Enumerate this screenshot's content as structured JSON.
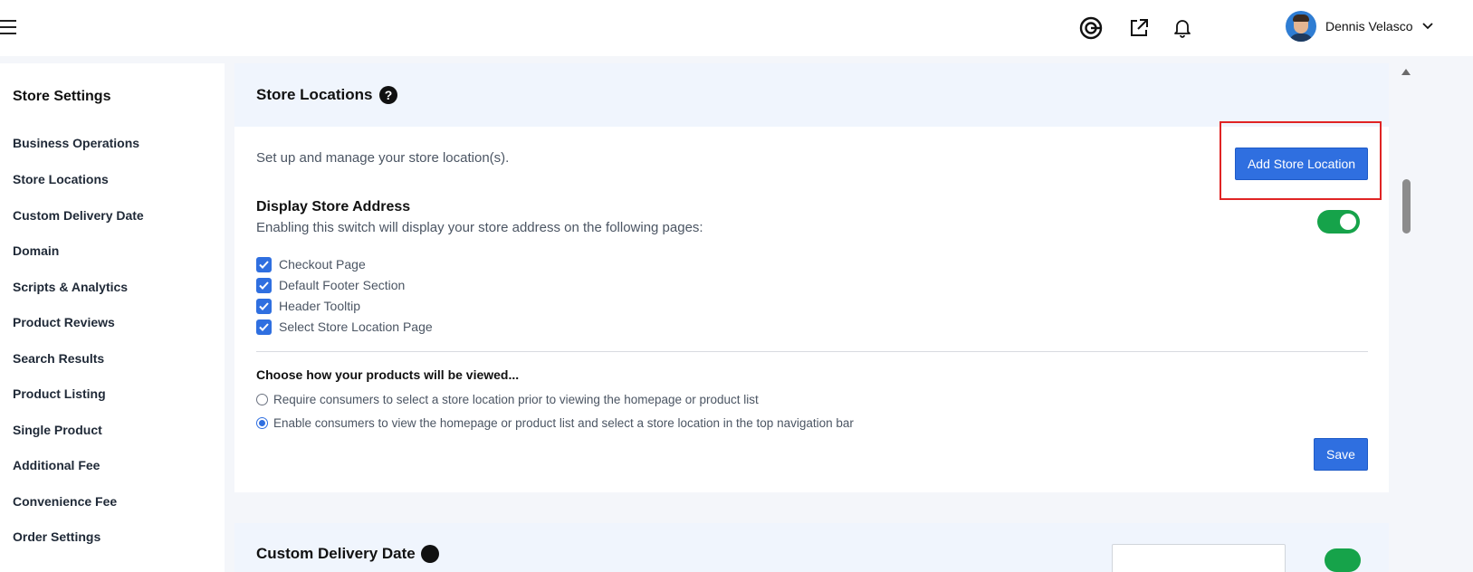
{
  "header": {
    "user_name": "Dennis Velasco",
    "icons": [
      "menu-icon",
      "target-icon",
      "external-link-icon",
      "bell-icon",
      "chevron-down-icon"
    ]
  },
  "sidebar": {
    "title": "Store Settings",
    "items": [
      {
        "label": "Business Operations"
      },
      {
        "label": "Store Locations"
      },
      {
        "label": "Custom Delivery Date"
      },
      {
        "label": "Domain"
      },
      {
        "label": "Scripts & Analytics"
      },
      {
        "label": "Product Reviews"
      },
      {
        "label": "Search Results"
      },
      {
        "label": "Product Listing"
      },
      {
        "label": "Single Product"
      },
      {
        "label": "Additional Fee"
      },
      {
        "label": "Convenience Fee"
      },
      {
        "label": "Order Settings"
      }
    ]
  },
  "store_locations": {
    "title": "Store Locations",
    "help_glyph": "?",
    "description": "Set up and manage your store location(s).",
    "add_button": "Add Store Location",
    "display_title": "Display Store Address",
    "display_subtitle": "Enabling this switch will display your store address on the following pages:",
    "display_enabled": true,
    "checkboxes": [
      {
        "label": "Checkout Page",
        "checked": true
      },
      {
        "label": "Default Footer Section",
        "checked": true
      },
      {
        "label": "Header Tooltip",
        "checked": true
      },
      {
        "label": "Select Store Location Page",
        "checked": true
      }
    ],
    "view_title": "Choose how your products will be viewed...",
    "view_options": [
      {
        "label": "Require consumers to select a store location prior to viewing the homepage or product list",
        "selected": false
      },
      {
        "label": "Enable consumers to view the homepage or product list and select a store location in the top navigation bar",
        "selected": true
      }
    ],
    "save_button": "Save"
  },
  "next_section": {
    "title": "Custom Delivery Date"
  },
  "colors": {
    "primary": "#2f6fe0",
    "toggle_on": "#16a34a",
    "highlight": "#e02424"
  }
}
